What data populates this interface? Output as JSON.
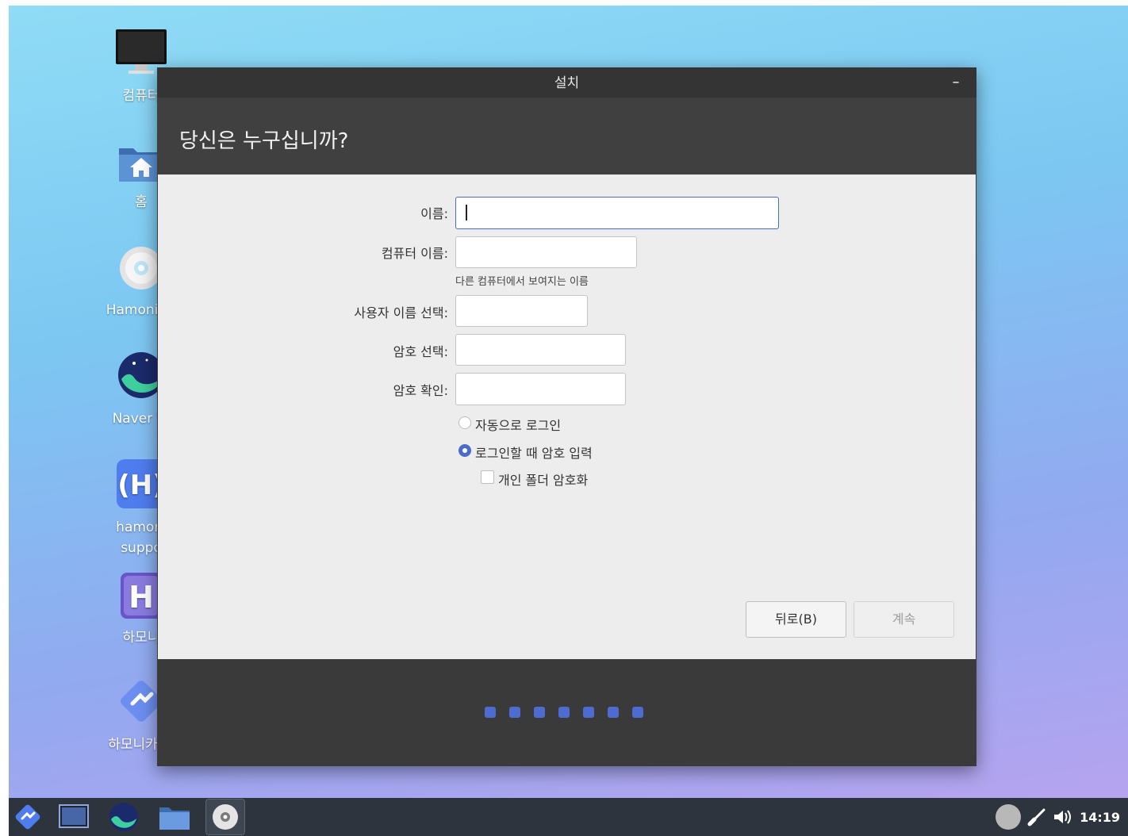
{
  "desktop": {
    "icons": [
      {
        "name": "computer",
        "label": "컴퓨터"
      },
      {
        "name": "home",
        "label": "홈"
      },
      {
        "name": "disc",
        "label": "HamoniKR"
      },
      {
        "name": "naver",
        "label": "Naver W"
      },
      {
        "name": "hamonikr-support",
        "label_line1": "hamoni",
        "label_line2": "suppo"
      },
      {
        "name": "hamonikr-h",
        "label": "하모니"
      },
      {
        "name": "hamonikr-community",
        "label": "하모니카 커"
      }
    ]
  },
  "window": {
    "title": "설치",
    "minimize_label": "–",
    "heading": "당신은 누구십니까?",
    "form": {
      "name_label": "이름:",
      "computer_name_label": "컴퓨터 이름:",
      "computer_name_hint": "다른 컴퓨터에서 보여지는 이름",
      "username_label": "사용자 이름 선택:",
      "password_label": "암호 선택:",
      "confirm_label": "암호 확인:",
      "name_value": "",
      "computer_name_value": "",
      "username_value": "",
      "password_value": "",
      "confirm_value": ""
    },
    "options": {
      "auto_login": "자동으로 로그인",
      "require_password": "로그인할 때 암호 입력",
      "encrypt_home": "개인 폴더 암호화",
      "selected": "require_password",
      "encrypt_home_checked": false
    },
    "buttons": {
      "back": "뒤로(B)",
      "continue": "계속"
    },
    "progress": {
      "total_steps": 7
    }
  },
  "taskbar": {
    "clock": "14:19",
    "items": [
      "start-menu",
      "show-desktop",
      "naver-whale",
      "file-manager",
      "installer-disc"
    ]
  },
  "colors": {
    "accent": "#4a6bc8",
    "progress_dot": "#4e6bd0",
    "window_bg": "#3a3a3a",
    "content_bg": "#ededed",
    "taskbar_bg": "#2e343d"
  }
}
